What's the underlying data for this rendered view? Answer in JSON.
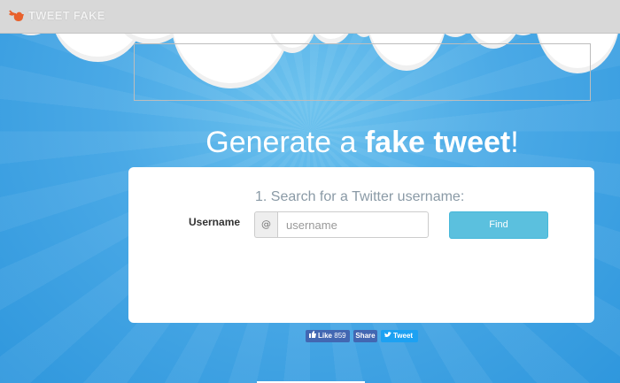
{
  "app": {
    "name": "TWEET FAKE",
    "logo_icon": "bird-icon"
  },
  "headline": {
    "prefix": "Generate a ",
    "bold": "fake tweet",
    "suffix": "!"
  },
  "form": {
    "step_title": "1. Search for a Twitter username:",
    "username_label": "Username",
    "at_prefix": "@",
    "username_placeholder": "username",
    "username_value": "",
    "find_label": "Find"
  },
  "social": {
    "like_label": "Like",
    "like_count": "859",
    "share_label": "Share",
    "tweet_label": "Tweet"
  },
  "colors": {
    "sky": "#3fa3e2",
    "topbar": "#d8d8d8",
    "logo_orange": "#e8612c",
    "find_button": "#5bc0de",
    "facebook": "#4267b2",
    "twitter": "#1da1f2"
  }
}
